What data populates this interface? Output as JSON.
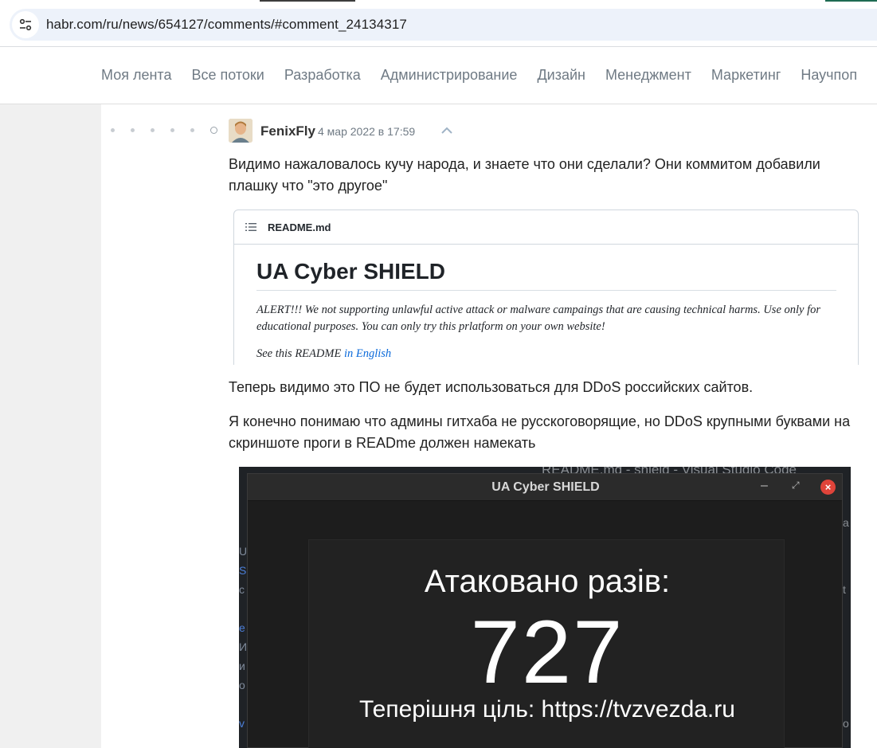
{
  "browser": {
    "url": "habr.com/ru/news/654127/comments/#comment_24134317"
  },
  "nav": {
    "items": [
      "Моя лента",
      "Все потоки",
      "Разработка",
      "Администрирование",
      "Дизайн",
      "Менеджмент",
      "Маркетинг",
      "Научпоп"
    ]
  },
  "comment": {
    "author": "FenixFly",
    "date": "4 мар 2022 в 17:59",
    "para1": "Видимо нажаловалось кучу народа, и знаете что они сделали? Они коммитом добавили плашку что \"это другое\"",
    "para2": "Теперь видимо это ПО не будет использоваться для DDoS российских сайтов.",
    "para3": "Я конечно понимаю что админы гитхаба не русскоговорящие, но DDoS крупными буквами на скриншоте проги в READme должен намекать"
  },
  "readme": {
    "filename": "README.md",
    "title": "UA Cyber SHIELD",
    "alert": "ALERT!!! We not supporting unlawful active attack or malware campaings that are causing technical harms. Use only for educational purposes. You can only try this prlatform on your own website!",
    "see_prefix": "See this README",
    "see_link": "in English"
  },
  "app_screenshot": {
    "background_title": "README.md - shield - Visual Studio Code",
    "window_title": "UA Cyber SHIELD",
    "attack_label": "Атаковано разів:",
    "attack_count": "727",
    "target": "Теперішня ціль: https://tvzvezda.ru"
  },
  "colors": {
    "nav_text": "#6f7a84",
    "link": "#0969da",
    "close_button": "#e0443a"
  }
}
